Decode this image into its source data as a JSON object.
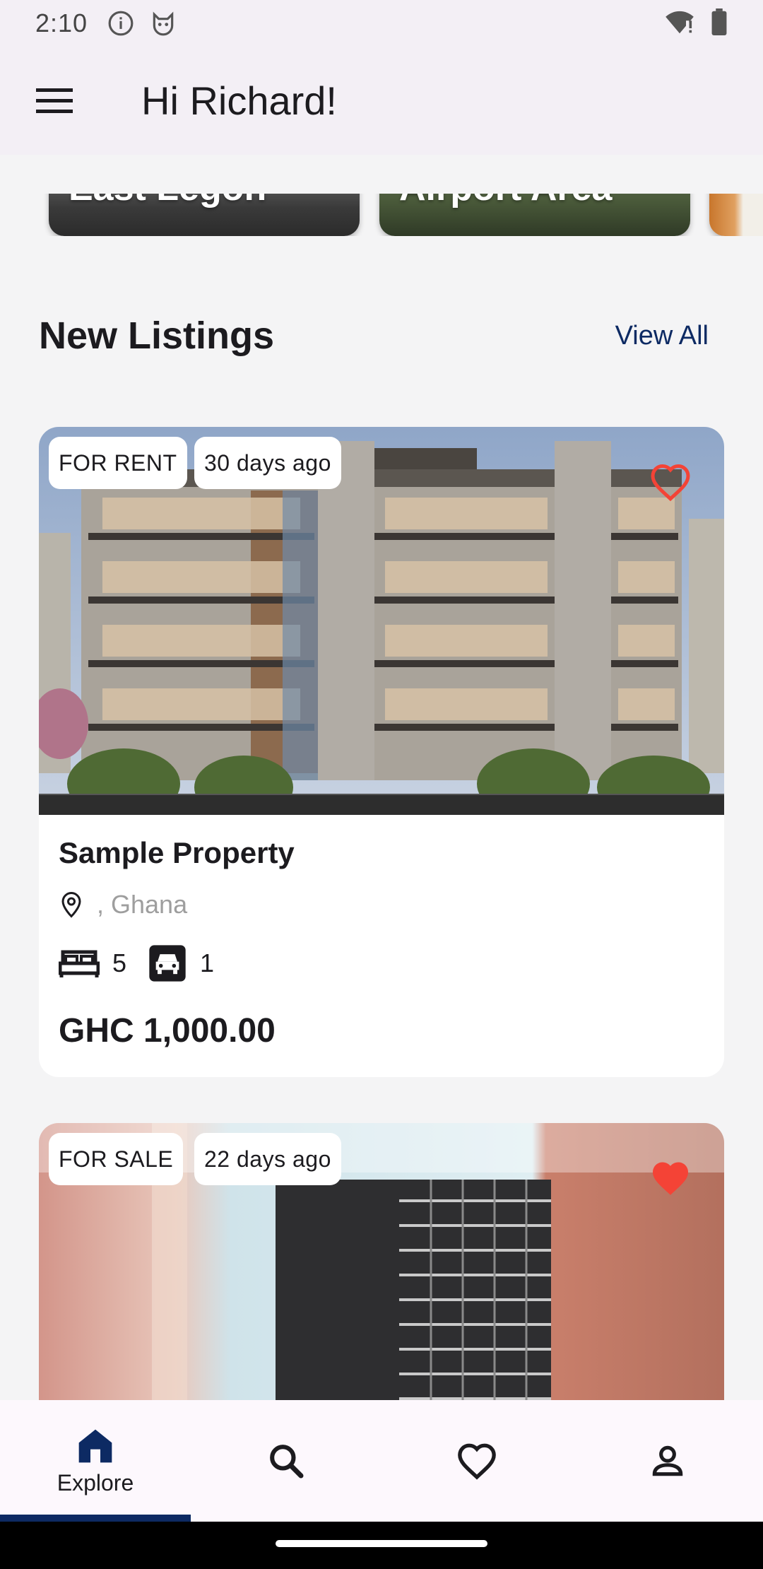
{
  "status_bar": {
    "time": "2:10"
  },
  "app_bar": {
    "greeting": "Hi Richard!"
  },
  "areas": [
    {
      "label": "East Legon"
    },
    {
      "label": "Airport Area"
    }
  ],
  "section": {
    "title": "New Listings",
    "view_all": "View All"
  },
  "listings": [
    {
      "status": "FOR RENT",
      "age": "30 days ago",
      "favorited": false,
      "name": "Sample Property",
      "location": ", Ghana",
      "beds": "5",
      "garages": "1",
      "price": "GHC 1,000.00"
    },
    {
      "status": "FOR SALE",
      "age": "22 days ago",
      "favorited": true
    }
  ],
  "bottom_nav": {
    "explore_label": "Explore",
    "active": "explore"
  },
  "colors": {
    "accent": "#0d2a63",
    "heart": "#f44336",
    "surface": "#f3eff5"
  },
  "icons": [
    "info-icon",
    "cat-icon",
    "wifi-icon",
    "battery-icon",
    "menu-icon",
    "location-pin-icon",
    "bed-icon",
    "car-icon",
    "heart-icon",
    "home-icon",
    "search-icon",
    "person-icon"
  ]
}
